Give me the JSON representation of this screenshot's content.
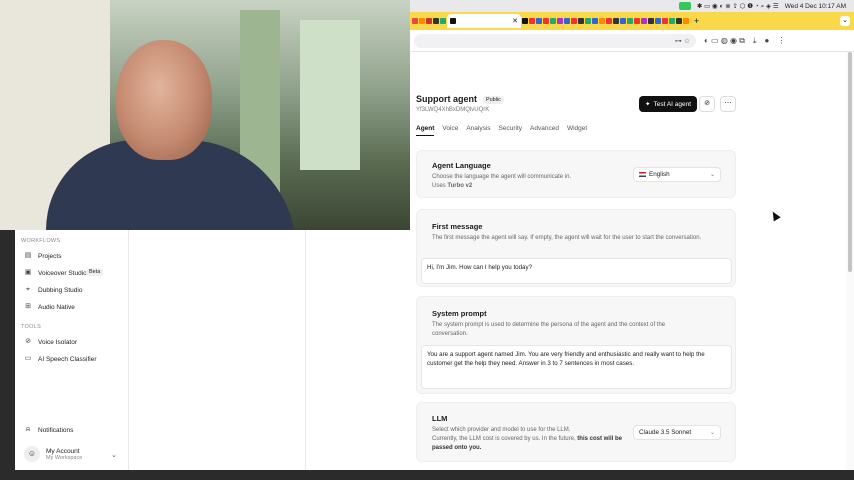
{
  "menubar": {
    "clock": "Wed 4 Dec 10:17 AM"
  },
  "colors": {
    "tabstrip": "#fbd74a",
    "primary_button": "#111111",
    "sidebar_bg": "#ffffff",
    "card_bg": "#f7f7f8"
  },
  "agent": {
    "title": "Support agent",
    "badge": "Public",
    "id": "Yf3LWQ4XhBxDMQlvUQrK",
    "test_button": "Test AI agent"
  },
  "tabs": [
    "Agent",
    "Voice",
    "Analysis",
    "Security",
    "Advanced",
    "Widget"
  ],
  "language": {
    "title": "Agent Language",
    "desc": "Choose the language the agent will communicate in.",
    "uses_prefix": "Uses",
    "uses_model": "Turbo v2",
    "selected": "English"
  },
  "first_message": {
    "title": "First message",
    "desc": "The first message the agent will say. If empty, the agent will wait for the user to start the conversation.",
    "value": "Hi, I'm Jim. How can I help you today?"
  },
  "system_prompt": {
    "title": "System prompt",
    "desc": "The system prompt is used to determine the persona of the agent and the context of the conversation.",
    "value": "You are a support agent named Jim. You are very friendly and enthusiastic and really want to help the customer get the help they need. Answer in 3 to 7 sentences in most cases."
  },
  "llm": {
    "title": "LLM",
    "desc": "Select which provider and model to use for the LLM.",
    "note_prefix": "Currently, the LLM cost is covered by us. In the future,",
    "note_bold": "this cost will be passed onto you.",
    "selected": "Claude 3.5 Sonnet"
  },
  "sidebar": {
    "workflows_label": "WORKFLOWS",
    "tools_label": "TOOLS",
    "items": [
      {
        "label": "Projects"
      },
      {
        "label": "Voiceover Studio"
      },
      {
        "label": "Dubbing Studio"
      },
      {
        "label": "Audio Native"
      },
      {
        "label": "Voice Isolator"
      },
      {
        "label": "AI Speech Classifier"
      }
    ],
    "beta": "Beta",
    "notifications": "Notifications",
    "account_name": "My Account",
    "workspace": "My Workspace"
  }
}
